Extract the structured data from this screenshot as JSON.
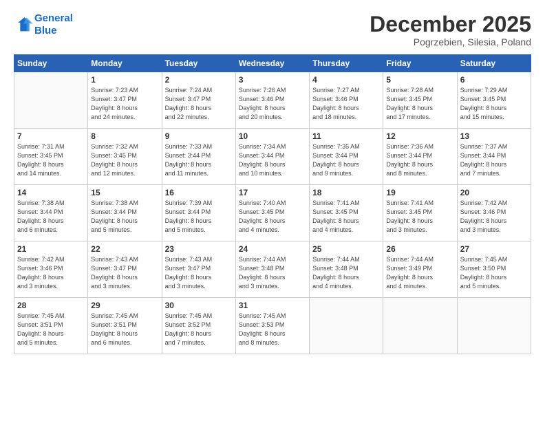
{
  "header": {
    "logo_line1": "General",
    "logo_line2": "Blue",
    "month": "December 2025",
    "location": "Pogrzebien, Silesia, Poland"
  },
  "days_of_week": [
    "Sunday",
    "Monday",
    "Tuesday",
    "Wednesday",
    "Thursday",
    "Friday",
    "Saturday"
  ],
  "weeks": [
    [
      {
        "day": "",
        "info": ""
      },
      {
        "day": "1",
        "info": "Sunrise: 7:23 AM\nSunset: 3:47 PM\nDaylight: 8 hours\nand 24 minutes."
      },
      {
        "day": "2",
        "info": "Sunrise: 7:24 AM\nSunset: 3:47 PM\nDaylight: 8 hours\nand 22 minutes."
      },
      {
        "day": "3",
        "info": "Sunrise: 7:26 AM\nSunset: 3:46 PM\nDaylight: 8 hours\nand 20 minutes."
      },
      {
        "day": "4",
        "info": "Sunrise: 7:27 AM\nSunset: 3:46 PM\nDaylight: 8 hours\nand 18 minutes."
      },
      {
        "day": "5",
        "info": "Sunrise: 7:28 AM\nSunset: 3:45 PM\nDaylight: 8 hours\nand 17 minutes."
      },
      {
        "day": "6",
        "info": "Sunrise: 7:29 AM\nSunset: 3:45 PM\nDaylight: 8 hours\nand 15 minutes."
      }
    ],
    [
      {
        "day": "7",
        "info": "Sunrise: 7:31 AM\nSunset: 3:45 PM\nDaylight: 8 hours\nand 14 minutes."
      },
      {
        "day": "8",
        "info": "Sunrise: 7:32 AM\nSunset: 3:45 PM\nDaylight: 8 hours\nand 12 minutes."
      },
      {
        "day": "9",
        "info": "Sunrise: 7:33 AM\nSunset: 3:44 PM\nDaylight: 8 hours\nand 11 minutes."
      },
      {
        "day": "10",
        "info": "Sunrise: 7:34 AM\nSunset: 3:44 PM\nDaylight: 8 hours\nand 10 minutes."
      },
      {
        "day": "11",
        "info": "Sunrise: 7:35 AM\nSunset: 3:44 PM\nDaylight: 8 hours\nand 9 minutes."
      },
      {
        "day": "12",
        "info": "Sunrise: 7:36 AM\nSunset: 3:44 PM\nDaylight: 8 hours\nand 8 minutes."
      },
      {
        "day": "13",
        "info": "Sunrise: 7:37 AM\nSunset: 3:44 PM\nDaylight: 8 hours\nand 7 minutes."
      }
    ],
    [
      {
        "day": "14",
        "info": "Sunrise: 7:38 AM\nSunset: 3:44 PM\nDaylight: 8 hours\nand 6 minutes."
      },
      {
        "day": "15",
        "info": "Sunrise: 7:38 AM\nSunset: 3:44 PM\nDaylight: 8 hours\nand 5 minutes."
      },
      {
        "day": "16",
        "info": "Sunrise: 7:39 AM\nSunset: 3:44 PM\nDaylight: 8 hours\nand 5 minutes."
      },
      {
        "day": "17",
        "info": "Sunrise: 7:40 AM\nSunset: 3:45 PM\nDaylight: 8 hours\nand 4 minutes."
      },
      {
        "day": "18",
        "info": "Sunrise: 7:41 AM\nSunset: 3:45 PM\nDaylight: 8 hours\nand 4 minutes."
      },
      {
        "day": "19",
        "info": "Sunrise: 7:41 AM\nSunset: 3:45 PM\nDaylight: 8 hours\nand 3 minutes."
      },
      {
        "day": "20",
        "info": "Sunrise: 7:42 AM\nSunset: 3:46 PM\nDaylight: 8 hours\nand 3 minutes."
      }
    ],
    [
      {
        "day": "21",
        "info": "Sunrise: 7:42 AM\nSunset: 3:46 PM\nDaylight: 8 hours\nand 3 minutes."
      },
      {
        "day": "22",
        "info": "Sunrise: 7:43 AM\nSunset: 3:47 PM\nDaylight: 8 hours\nand 3 minutes."
      },
      {
        "day": "23",
        "info": "Sunrise: 7:43 AM\nSunset: 3:47 PM\nDaylight: 8 hours\nand 3 minutes."
      },
      {
        "day": "24",
        "info": "Sunrise: 7:44 AM\nSunset: 3:48 PM\nDaylight: 8 hours\nand 3 minutes."
      },
      {
        "day": "25",
        "info": "Sunrise: 7:44 AM\nSunset: 3:48 PM\nDaylight: 8 hours\nand 4 minutes."
      },
      {
        "day": "26",
        "info": "Sunrise: 7:44 AM\nSunset: 3:49 PM\nDaylight: 8 hours\nand 4 minutes."
      },
      {
        "day": "27",
        "info": "Sunrise: 7:45 AM\nSunset: 3:50 PM\nDaylight: 8 hours\nand 5 minutes."
      }
    ],
    [
      {
        "day": "28",
        "info": "Sunrise: 7:45 AM\nSunset: 3:51 PM\nDaylight: 8 hours\nand 5 minutes."
      },
      {
        "day": "29",
        "info": "Sunrise: 7:45 AM\nSunset: 3:51 PM\nDaylight: 8 hours\nand 6 minutes."
      },
      {
        "day": "30",
        "info": "Sunrise: 7:45 AM\nSunset: 3:52 PM\nDaylight: 8 hours\nand 7 minutes."
      },
      {
        "day": "31",
        "info": "Sunrise: 7:45 AM\nSunset: 3:53 PM\nDaylight: 8 hours\nand 8 minutes."
      },
      {
        "day": "",
        "info": ""
      },
      {
        "day": "",
        "info": ""
      },
      {
        "day": "",
        "info": ""
      }
    ]
  ]
}
